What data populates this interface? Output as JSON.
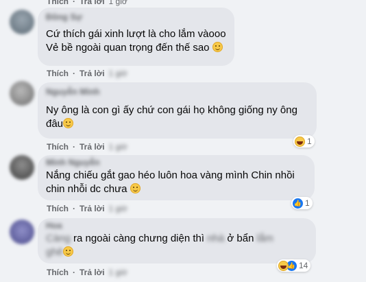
{
  "labels": {
    "like": "Thích",
    "reply": "Trả lời",
    "dot": "·"
  },
  "comments": [
    {
      "author": "Đông Sự",
      "time": "1 giờ",
      "lines": [
        "Cứ thích gái xinh lượt là cho lắm vàooo",
        "Vẻ bề ngoài quan trọng đến thế sao"
      ],
      "reactions": ""
    },
    {
      "author": "Nguyễn Minh",
      "time": "1 giờ",
      "lines": [
        "Ny ông là con gì ấy chứ con gái họ không giống ny ông",
        "đâu"
      ],
      "reactions": "1"
    },
    {
      "author": "Minh Nguyễn",
      "time": "1 giờ",
      "lines": [
        "Nắng chiếu gắt gao héo luôn hoa vàng mình Chin nhồi",
        "chin nhỗi dc chưa"
      ],
      "reactions": "1"
    },
    {
      "author": "Hoa",
      "time": "1 giờ",
      "line1_hidden": "Càng",
      "line1_a": "ra ngoài càng chưng diện thì",
      "line1_hidden2": "nhà",
      "line1_b": "ở bẩn",
      "line1_hidden3": "lắm",
      "line2_hidden": "ghê",
      "reactions": "14"
    }
  ],
  "colors": {
    "bubble": "#e4e6eb",
    "page": "#f0f2f5",
    "like_blue": "#1877f2",
    "haha_yellow": "#f7c948"
  }
}
